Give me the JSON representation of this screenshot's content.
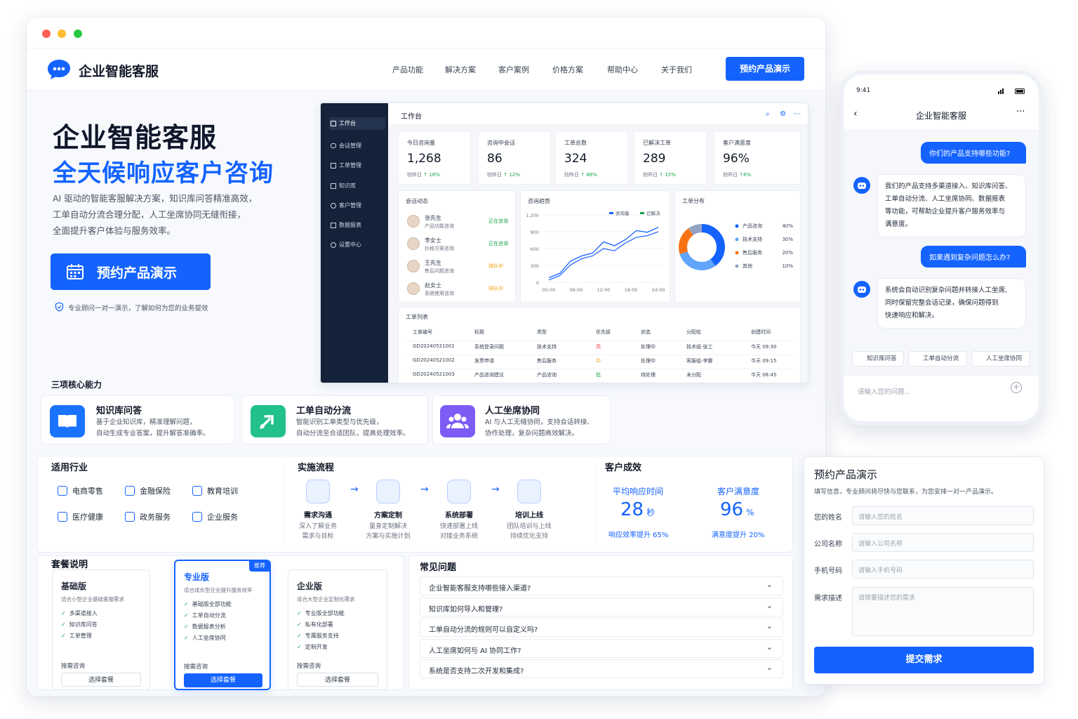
{
  "brand": "企业智能客服",
  "nav": [
    "产品功能",
    "解决方案",
    "客户案例",
    "价格方案",
    "帮助中心",
    "关于我们"
  ],
  "nav_cta": "预约产品演示",
  "hero": {
    "title": "企业智能客服",
    "subtitle": "全天候响应客户咨询",
    "desc": [
      "AI 驱动的智能客服解决方案，知识库问答精准高效，",
      "工单自动分流合理分配，人工坐席协同无缝衔接，",
      "全面提升客户体验与服务效率。"
    ],
    "cta": "预约产品演示",
    "note": "专业顾问一对一演示，了解如何为您的业务提效"
  },
  "dashboard": {
    "sidebar": [
      "工作台",
      "会话管理",
      "工单管理",
      "知识库",
      "客户管理",
      "数据报表",
      "设置中心"
    ],
    "title": "工作台",
    "kpis": [
      {
        "label": "今日咨询量",
        "value": "1,268",
        "cmp": "较昨日",
        "chg": "↑ 18%"
      },
      {
        "label": "咨询中会话",
        "value": "86",
        "cmp": "较昨日",
        "chg": "↑ 12%"
      },
      {
        "label": "工单总数",
        "value": "324",
        "cmp": "较昨日",
        "chg": "↑ 88%"
      },
      {
        "label": "已解决工单",
        "value": "289",
        "cmp": "较昨日",
        "chg": "↑ 15%"
      },
      {
        "label": "客户满意度",
        "value": "96%",
        "cmp": "较昨日",
        "chg": "↑6%"
      }
    ],
    "sessions": {
      "title": "会话动态",
      "items": [
        {
          "name": "张先生",
          "topic": "产品功能咨询",
          "status": "正在咨询",
          "color": "#16a34a"
        },
        {
          "name": "李女士",
          "topic": "价格方案咨询",
          "status": "正在咨询",
          "color": "#16a34a"
        },
        {
          "name": "王先生",
          "topic": "售后问题咨询",
          "status": "排队中",
          "color": "#f59e0b"
        },
        {
          "name": "赵女士",
          "topic": "系统使用咨询",
          "status": "排队中",
          "color": "#f59e0b"
        }
      ]
    },
    "trend": {
      "title": "咨询趋势",
      "legend": [
        "咨询量",
        "已解决"
      ]
    },
    "dist": {
      "title": "工单分布",
      "items": [
        {
          "label": "产品咨询",
          "pct": "40%",
          "color": "#1463ff"
        },
        {
          "label": "技术支持",
          "pct": "30%",
          "color": "#60a5fa"
        },
        {
          "label": "售后服务",
          "pct": "20%",
          "color": "#f97316"
        },
        {
          "label": "其他",
          "pct": "10%",
          "color": "#93a3c4"
        }
      ]
    },
    "tickets": {
      "title": "工单列表",
      "headers": [
        "工单编号",
        "标题",
        "类型",
        "优先级",
        "状态",
        "分配给",
        "创建时间"
      ],
      "rows": [
        [
          "GD20240521001",
          "系统登录问题",
          "技术支持",
          "高",
          "处理中",
          "技术组-张工",
          "今天 09:30"
        ],
        [
          "GD20240521002",
          "发票申请",
          "售后服务",
          "中",
          "处理中",
          "客服组-李娜",
          "今天 09:15"
        ],
        [
          "GD20240521003",
          "产品咨询建议",
          "产品咨询",
          "低",
          "待处理",
          "未分配",
          "今天 08:45"
        ]
      ]
    }
  },
  "chart_data": [
    {
      "type": "line",
      "title": "咨询趋势",
      "x": [
        "00:00",
        "06:00",
        "12:00",
        "18:00",
        "24:00"
      ],
      "ylim": [
        0,
        1200
      ],
      "yticks": [
        "1,200",
        "900",
        "600",
        "300",
        "0"
      ],
      "series": [
        {
          "name": "咨询量",
          "values": [
            80,
            160,
            380,
            470,
            520,
            720,
            650,
            760,
            920,
            890,
            980
          ]
        },
        {
          "name": "已解决",
          "values": [
            40,
            120,
            310,
            420,
            470,
            600,
            560,
            700,
            800,
            830,
            900
          ]
        }
      ]
    },
    {
      "type": "pie",
      "title": "工单分布",
      "categories": [
        "产品咨询",
        "技术支持",
        "售后服务",
        "其他"
      ],
      "values": [
        40,
        30,
        20,
        10
      ]
    }
  ],
  "features": {
    "title": "三项核心能力",
    "items": [
      {
        "title": "知识库问答",
        "desc": [
          "基于企业知识库，精准理解问题，",
          "自动生成专业答案，提升解答准确率。"
        ]
      },
      {
        "title": "工单自动分流",
        "desc": [
          "智能识别工单类型与优先级，",
          "自动分流至合适团队，提高处理效率。"
        ]
      },
      {
        "title": "人工坐席协同",
        "desc": [
          "AI 与人工无缝协同，支持会话转接、",
          "协作处理，复杂问题高效解决。"
        ]
      }
    ]
  },
  "industries": {
    "title": "适用行业",
    "items": [
      "电商零售",
      "金融保险",
      "教育培训",
      "医疗健康",
      "政务服务",
      "企业服务"
    ]
  },
  "process": {
    "title": "实施流程",
    "steps": [
      {
        "t": "需求沟通",
        "d": [
          "深入了解业务",
          "需求与目标"
        ]
      },
      {
        "t": "方案定制",
        "d": [
          "量身定制解决",
          "方案与实施计划"
        ]
      },
      {
        "t": "系统部署",
        "d": [
          "快速部署上线",
          "对接业务系统"
        ]
      },
      {
        "t": "培训上线",
        "d": [
          "团队培训与上线",
          "持续优化支持"
        ]
      }
    ]
  },
  "results": {
    "title": "客户成效",
    "items": [
      {
        "label": "平均响应时间",
        "value": "28",
        "unit": "秒",
        "foot": "响应效率提升 65%"
      },
      {
        "label": "客户满意度",
        "value": "96",
        "unit": "%",
        "foot": "满意度提升 20%"
      }
    ]
  },
  "plans": {
    "title": "套餐说明",
    "recommend": "推荐",
    "items": [
      {
        "name": "基础版",
        "desc": "适合小型企业基础客服需求",
        "feats": [
          "多渠道接入",
          "知识库问答",
          "工单管理"
        ],
        "consult": "按需咨询",
        "btn": "选择套餐"
      },
      {
        "name": "专业版",
        "desc": "适合成长型企业提升服务效率",
        "feats": [
          "基础版全部功能",
          "工单自动分流",
          "数据报表分析",
          "人工坐席协同"
        ],
        "consult": "按需咨询",
        "btn": "选择套餐"
      },
      {
        "name": "企业版",
        "desc": "适合大型企业定制化需求",
        "feats": [
          "专业版全部功能",
          "私有化部署",
          "专属服务支持",
          "定制开发"
        ],
        "consult": "按需咨询",
        "btn": "选择套餐"
      }
    ]
  },
  "faq": {
    "title": "常见问题",
    "items": [
      "企业智能客服支持哪些接入渠道?",
      "知识库如何导入和管理?",
      "工单自动分流的规则可以自定义吗?",
      "人工坐席如何与 AI 协同工作?",
      "系统是否支持二次开发和集成?"
    ]
  },
  "phone": {
    "time": "9:41",
    "title": "企业智能客服",
    "msgs": [
      {
        "u": "你们的产品支持哪些功能?"
      },
      {
        "b": [
          "我们的产品支持多渠道接入、知识库问答、",
          "工单自动分流、人工坐席协同、数据报表",
          "等功能，可帮助企业提升客户服务效率与",
          "满意度。"
        ]
      },
      {
        "u": "如果遇到复杂问题怎么办?"
      },
      {
        "b": [
          "系统会自动识别复杂问题并转接人工坐席,",
          "同时保留完整会话记录，确保问题得到",
          "快速响应和解决。"
        ]
      }
    ],
    "chips": [
      "知识库问答",
      "工单自动分流",
      "人工坐席协同"
    ],
    "placeholder": "请输入您的问题..."
  },
  "form": {
    "title": "预约产品演示",
    "sub": "填写信息，专业顾问将尽快与您联系，为您安排一对一产品演示。",
    "fields": [
      {
        "label": "您的姓名",
        "ph": "请输入您的姓名"
      },
      {
        "label": "公司名称",
        "ph": "请输入公司名称"
      },
      {
        "label": "手机号码",
        "ph": "请输入手机号码"
      },
      {
        "label": "需求描述",
        "ph": "请简要描述您的需求"
      }
    ],
    "submit": "提交需求"
  }
}
